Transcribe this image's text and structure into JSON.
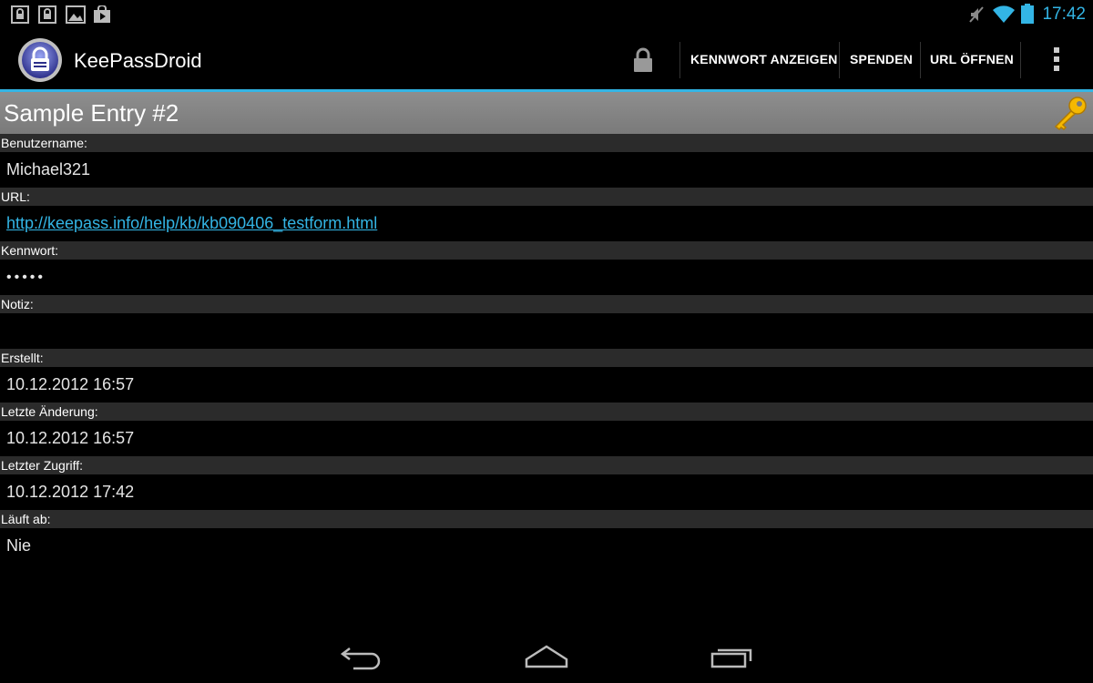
{
  "status_bar": {
    "time": "17:42",
    "left_icons": [
      "lock-notification-icon",
      "lock-notification-icon",
      "image-notification-icon",
      "play-store-notification-icon"
    ],
    "right_icons": [
      "mute-icon",
      "wifi-icon",
      "battery-icon"
    ]
  },
  "action_bar": {
    "title": "KeePassDroid",
    "buttons": {
      "show_password": "KENNWORT ANZEIGEN",
      "donate": "SPENDEN",
      "open_url": "URL ÖFFNEN"
    }
  },
  "entry": {
    "title": "Sample Entry #2"
  },
  "fields": [
    {
      "label": "Benutzername:",
      "value": "Michael321"
    },
    {
      "label": "URL:",
      "value": "http://keepass.info/help/kb/kb090406_testform.html"
    },
    {
      "label": "Kennwort:",
      "value": "•••••"
    },
    {
      "label": "Notiz:",
      "value": ""
    },
    {
      "label": "Erstellt:",
      "value": "10.12.2012 16:57"
    },
    {
      "label": "Letzte Änderung:",
      "value": "10.12.2012 16:57"
    },
    {
      "label": "Letzter Zugriff:",
      "value": "10.12.2012 17:42"
    },
    {
      "label": "Läuft ab:",
      "value": "Nie"
    }
  ],
  "colors": {
    "accent": "#33b5e5",
    "label_background": "#2b2b2b",
    "title_background": "#8e8e8e"
  }
}
